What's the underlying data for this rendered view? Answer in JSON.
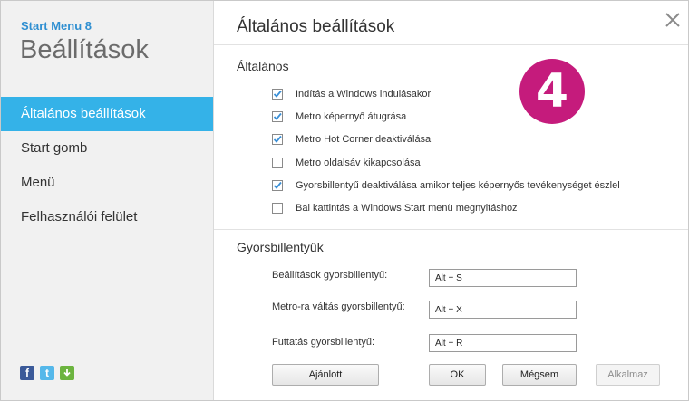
{
  "sidebar": {
    "app_name": "Start Menu 8",
    "heading": "Beállítások",
    "items": [
      {
        "label": "Általános beállítások",
        "active": true
      },
      {
        "label": "Start gomb",
        "active": false
      },
      {
        "label": "Menü",
        "active": false
      },
      {
        "label": "Felhasználói felület",
        "active": false
      }
    ],
    "social_icons": [
      "facebook-icon",
      "twitter-icon",
      "download-icon"
    ]
  },
  "main": {
    "title": "Általános beállítások",
    "badge": "4",
    "general": {
      "title": "Általános",
      "options": [
        {
          "label": "Indítás a Windows indulásakor",
          "checked": true
        },
        {
          "label": "Metro képernyő átugrása",
          "checked": true
        },
        {
          "label": "Metro Hot Corner deaktiválása",
          "checked": true
        },
        {
          "label": "Metro oldalsáv kikapcsolása",
          "checked": false
        },
        {
          "label": "Gyorsbillentyű deaktiválása amikor teljes képernyős tevékenységet észlel",
          "checked": true
        },
        {
          "label": "Bal kattintás a Windows Start menü megnyitáshoz",
          "checked": false
        }
      ]
    },
    "hotkeys": {
      "title": "Gyorsbillentyűk",
      "rows": [
        {
          "label": "Beállítások gyorsbillentyű:",
          "value": "Alt + S"
        },
        {
          "label": "Metro-ra váltás gyorsbillentyű:",
          "value": "Alt + X"
        },
        {
          "label": "Futtatás gyorsbillentyű:",
          "value": "Alt + R"
        }
      ]
    },
    "buttons": {
      "recommended": "Ajánlott",
      "ok": "OK",
      "cancel": "Mégsem",
      "apply": "Alkalmaz"
    }
  },
  "colors": {
    "accent": "#34b2e8",
    "app_name": "#2f8fd1",
    "badge": "#c51b7c",
    "checkbox_check": "#3a8fd6"
  }
}
